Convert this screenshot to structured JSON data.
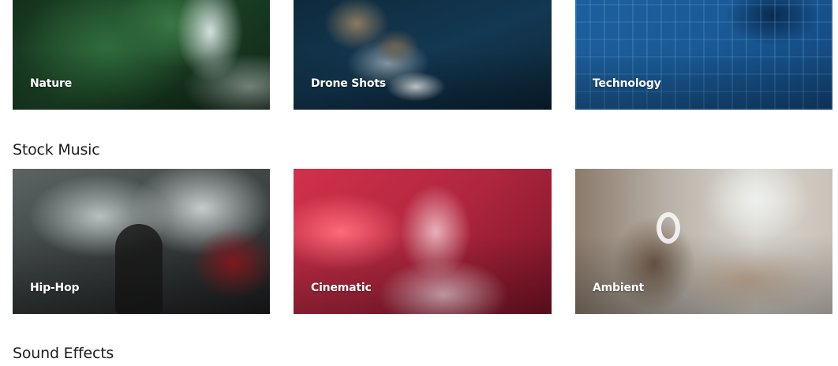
{
  "categories_top": [
    {
      "label": "Nature"
    },
    {
      "label": "Drone Shots"
    },
    {
      "label": "Technology"
    }
  ],
  "stock_music": {
    "title": "Stock Music",
    "items": [
      {
        "label": "Hip-Hop"
      },
      {
        "label": "Cinematic"
      },
      {
        "label": "Ambient"
      }
    ]
  },
  "sound_effects": {
    "title": "Sound Effects"
  }
}
